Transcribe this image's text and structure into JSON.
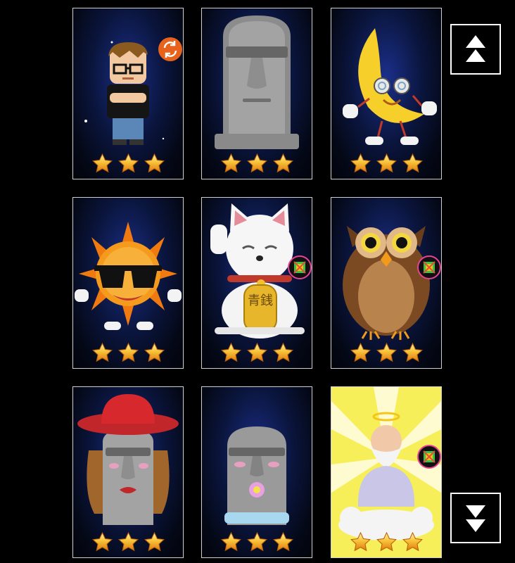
{
  "grid": {
    "cards": [
      {
        "character": "nerd-boy",
        "stars": 3,
        "badge": "swap-icon"
      },
      {
        "character": "moai-statue",
        "stars": 3,
        "badge": ""
      },
      {
        "character": "crescent-moon",
        "stars": 3,
        "badge": ""
      },
      {
        "character": "cool-sun",
        "stars": 3,
        "badge": ""
      },
      {
        "character": "maneki-neko",
        "stars": 3,
        "badge": "rainbow-badge-icon",
        "coin_text": "青銭"
      },
      {
        "character": "owl",
        "stars": 3,
        "badge": "rainbow-badge-icon"
      },
      {
        "character": "moai-with-hat",
        "stars": 3,
        "badge": ""
      },
      {
        "character": "small-moai",
        "stars": 3,
        "badge": ""
      },
      {
        "character": "old-sage",
        "stars": 3,
        "badge": "rainbow-badge-icon"
      }
    ]
  },
  "controls": {
    "scroll_up_icon": "double-up-arrow-icon",
    "scroll_down_icon": "double-down-arrow-icon"
  },
  "colors": {
    "background": "#000000",
    "card_border": "#cfcfcf",
    "star": "#f5a623",
    "badge_orange": "#e8621c"
  }
}
